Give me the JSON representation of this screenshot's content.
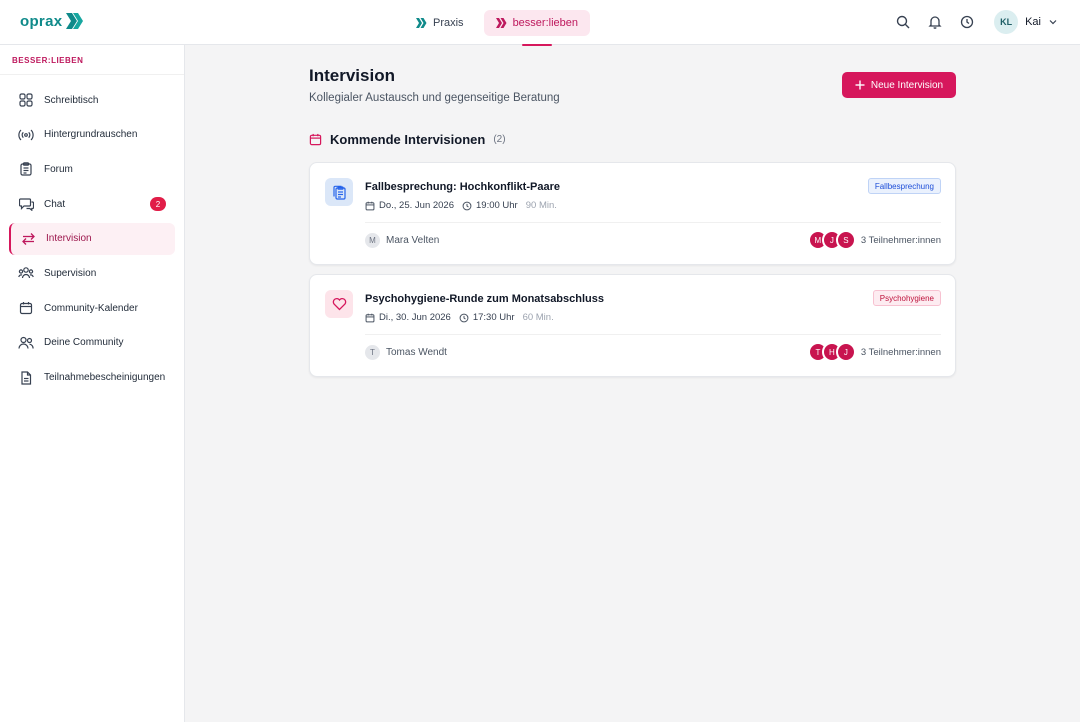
{
  "header": {
    "logo_text": "oprax",
    "switcher": [
      {
        "label": "Praxis"
      },
      {
        "label": "besser:lieben"
      }
    ],
    "user": {
      "initials": "KL",
      "name": "Kai"
    },
    "colors": {
      "accent": "#d6175c",
      "brand_teal": "#0f8a8a"
    }
  },
  "sidebar": {
    "section_title": "BESSER:LIEBEN",
    "items": [
      {
        "label": "Schreibtisch",
        "icon": "grid-icon"
      },
      {
        "label": "Hintergrundrauschen",
        "icon": "broadcast-icon"
      },
      {
        "label": "Forum",
        "icon": "clipboard-icon"
      },
      {
        "label": "Chat",
        "icon": "chat-icon",
        "badge": "2"
      },
      {
        "label": "Intervision",
        "icon": "arrows-exchange-icon",
        "active": true
      },
      {
        "label": "Supervision",
        "icon": "users-group-icon"
      },
      {
        "label": "Community-Kalender",
        "icon": "calendar-icon"
      },
      {
        "label": "Deine Community",
        "icon": "users-icon"
      },
      {
        "label": "Teilnahmebescheinigungen",
        "icon": "document-icon"
      }
    ]
  },
  "main": {
    "title": "Intervision",
    "subtitle": "Kollegialer Austausch und gegenseitige Beratung",
    "new_button_label": "Neue Intervision",
    "section_title": "Kommende Intervisionen",
    "section_count": "(2)",
    "sessions": [
      {
        "title": "Fallbesprechung: Hochkonflikt-Paare",
        "date": "Do., 25. Jun 2026",
        "time": "19:00 Uhr",
        "duration": "90 Min.",
        "tag": "Fallbesprechung",
        "host_initial": "M",
        "host_name": "Mara Velten",
        "participant_initials": [
          "M",
          "J",
          "S"
        ],
        "participants_text": "3 Teilnehmer:innen",
        "icon": "clipboard-stack-icon"
      },
      {
        "title": "Psychohygiene-Runde zum Monatsabschluss",
        "date": "Di., 30. Jun 2026",
        "time": "17:30 Uhr",
        "duration": "60 Min.",
        "tag": "Psychohygiene",
        "host_initial": "T",
        "host_name": "Tomas Wendt",
        "participant_initials": [
          "T",
          "H",
          "J"
        ],
        "participants_text": "3 Teilnehmer:innen",
        "icon": "heart-icon"
      }
    ]
  }
}
